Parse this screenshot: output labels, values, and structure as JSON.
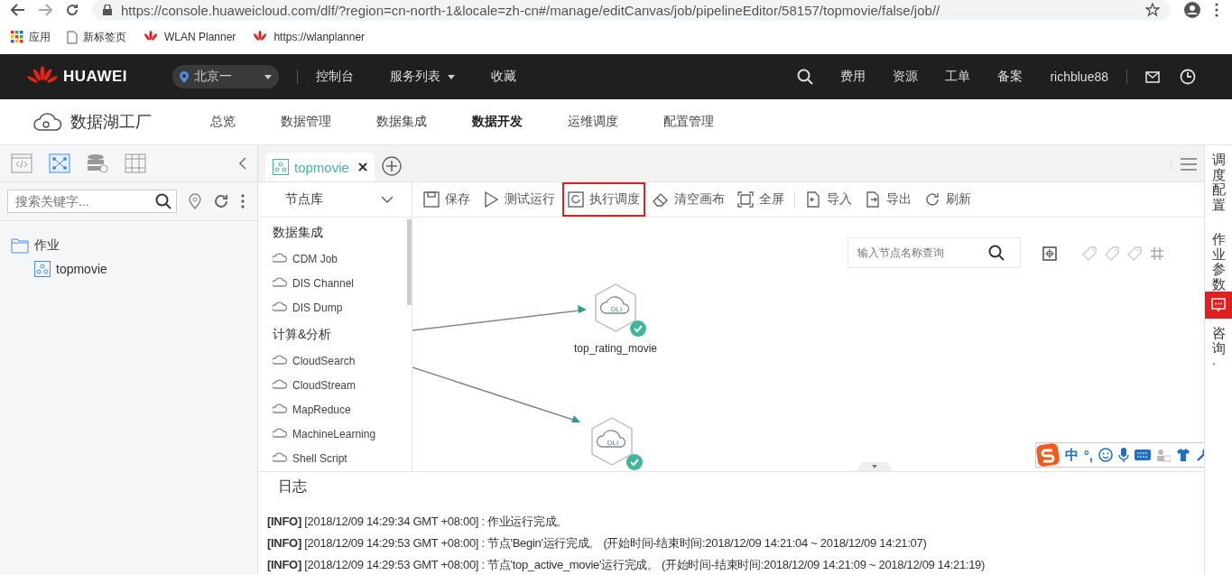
{
  "browser": {
    "url": "https://console.huaweicloud.com/dlf/?region=cn-north-1&locale=zh-cn#/manage/editCanvas/job/pipelineEditor/58157/topmovie/false/job//",
    "bookmarks": [
      "应用",
      "新标签页",
      "WLAN Planner",
      "https://wlanplanner"
    ]
  },
  "header": {
    "brand": "HUAWEI",
    "region": "北京一",
    "nav": [
      {
        "label": "控制台",
        "dropdown": false
      },
      {
        "label": "服务列表",
        "dropdown": true
      },
      {
        "label": "收藏",
        "dropdown": false
      }
    ],
    "links": [
      "费用",
      "资源",
      "工单",
      "备案"
    ],
    "user": "richblue88"
  },
  "product": {
    "name": "数据湖工厂",
    "tabs": [
      {
        "label": "总览",
        "selected": false
      },
      {
        "label": "数据管理",
        "selected": false
      },
      {
        "label": "数据集成",
        "selected": false
      },
      {
        "label": "数据开发",
        "selected": true
      },
      {
        "label": "运维调度",
        "selected": false
      },
      {
        "label": "配置管理",
        "selected": false
      }
    ]
  },
  "sidebar": {
    "modes": [
      {
        "kind": "script",
        "selected": false
      },
      {
        "kind": "job",
        "selected": true
      },
      {
        "kind": "data",
        "selected": false
      },
      {
        "kind": "resource",
        "selected": false
      }
    ],
    "search": {
      "placeholder": "搜索关键字..."
    },
    "tree": [
      {
        "label": "作业",
        "children": [
          {
            "label": "topmovie"
          }
        ]
      }
    ]
  },
  "editor_tabs": [
    {
      "label": "topmovie",
      "selected": true
    }
  ],
  "node_library": {
    "title": "节点库",
    "groups": [
      {
        "title": "数据集成",
        "items": [
          "CDM Job",
          "DIS Channel",
          "DIS Dump"
        ]
      },
      {
        "title": "计算&分析",
        "items": [
          "CloudSearch",
          "CloudStream",
          "MapReduce",
          "MachineLearning",
          "Shell Script"
        ]
      }
    ]
  },
  "toolbar": [
    {
      "label": "保存",
      "highlighted": false
    },
    {
      "label": "测试运行",
      "highlighted": false
    },
    {
      "label": "执行调度",
      "highlighted": true
    },
    {
      "label": "清空画布",
      "highlighted": false
    },
    {
      "label": "全屏",
      "highlighted": false
    },
    {
      "label": "导入",
      "highlighted": false
    },
    {
      "label": "导出",
      "highlighted": false
    },
    {
      "label": "刷新",
      "highlighted": false
    }
  ],
  "canvas": {
    "search": {
      "placeholder": "输入节点名称查询"
    },
    "nodes": [
      {
        "label": "top_rating_movie",
        "badge": "DLI",
        "done": true
      },
      {
        "badge": "DLI",
        "done": true
      }
    ]
  },
  "side_tabs": [
    "调度配置",
    "作业参数",
    "咨询·"
  ],
  "ime": {
    "mode": "中",
    "punct": "°,"
  },
  "log": {
    "title": "日志",
    "lines": [
      {
        "level": "[INFO]",
        "text": "[2018/12/09 14:29:34 GMT +08:00] : 作业运行完成。"
      },
      {
        "level": "[INFO]",
        "text": "[2018/12/09 14:29:53 GMT +08:00] : 节点'Begin'运行完成。 (开始时间-结束时间:2018/12/09 14:21:04 ~ 2018/12/09 14:21:07)"
      },
      {
        "level": "[INFO]",
        "text": "[2018/12/09 14:29:53 GMT +08:00] : 节点'top_active_movie'运行完成。 (开始时间-结束时间:2018/12/09 14:21:09 ~ 2018/12/09 14:21:19)"
      }
    ]
  }
}
